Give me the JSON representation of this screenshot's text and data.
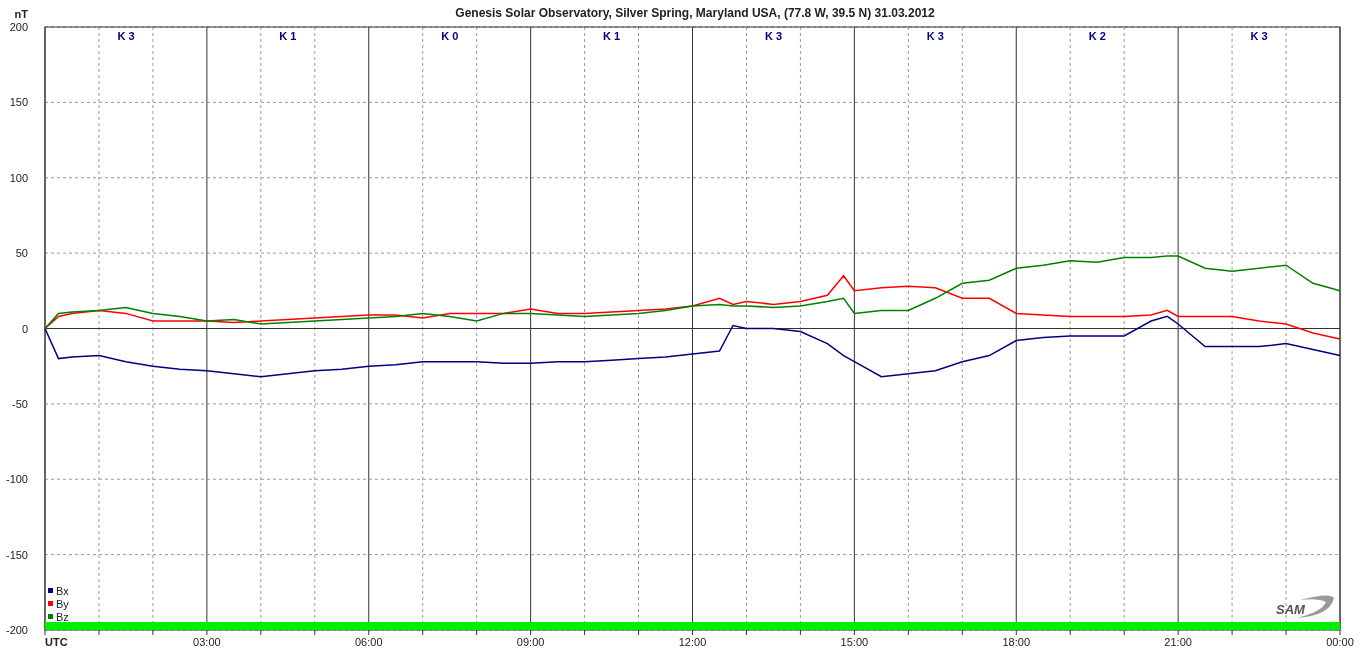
{
  "chart_data": {
    "type": "line",
    "title": "Genesis Solar Observatory, Silver Spring, Maryland USA, (77.8 W, 39.5 N)  31.03.2012",
    "ylabel": "nT",
    "xlim": [
      0,
      24
    ],
    "ylim": [
      -200,
      200
    ],
    "grid": true,
    "legend": true,
    "yticks": [
      -200,
      -150,
      -100,
      -50,
      0,
      50,
      100,
      150,
      200
    ],
    "xticks": [
      {
        "value": 0,
        "label": "UTC"
      },
      {
        "value": 3,
        "label": "03:00"
      },
      {
        "value": 6,
        "label": "06:00"
      },
      {
        "value": 9,
        "label": "09:00"
      },
      {
        "value": 12,
        "label": "12:00"
      },
      {
        "value": 15,
        "label": "15:00"
      },
      {
        "value": 18,
        "label": "18:00"
      },
      {
        "value": 21,
        "label": "21:00"
      },
      {
        "value": 24,
        "label": "00:00"
      }
    ],
    "x": [
      0,
      0.25,
      0.5,
      1,
      1.5,
      2,
      2.5,
      3,
      3.5,
      4,
      4.5,
      5,
      5.5,
      6,
      6.5,
      7,
      7.5,
      8,
      8.5,
      9,
      9.5,
      10,
      10.5,
      11,
      11.5,
      12,
      12.5,
      12.75,
      13,
      13.5,
      14,
      14.5,
      14.8,
      15,
      15.5,
      16,
      16.5,
      17,
      17.5,
      18,
      18.5,
      19,
      19.5,
      20,
      20.5,
      20.8,
      21,
      21.5,
      22,
      22.5,
      23,
      23.5,
      24
    ],
    "series": [
      {
        "name": "Bx",
        "color": "#000080",
        "values": [
          0,
          -20,
          -19,
          -18,
          -22,
          -25,
          -27,
          -28,
          -30,
          -32,
          -30,
          -28,
          -27,
          -25,
          -24,
          -22,
          -22,
          -22,
          -23,
          -23,
          -22,
          -22,
          -21,
          -20,
          -19,
          -17,
          -15,
          2,
          0,
          0,
          -2,
          -10,
          -18,
          -22,
          -32,
          -30,
          -28,
          -22,
          -18,
          -8,
          -6,
          -5,
          -5,
          -5,
          5,
          8,
          3,
          -12,
          -12,
          -12,
          -10,
          -14,
          -18
        ]
      },
      {
        "name": "By",
        "color": "#ff0000",
        "values": [
          0,
          8,
          10,
          12,
          10,
          5,
          5,
          5,
          4,
          5,
          6,
          7,
          8,
          9,
          9,
          7,
          10,
          10,
          10,
          13,
          10,
          10,
          11,
          12,
          13,
          15,
          20,
          16,
          18,
          16,
          18,
          22,
          35,
          25,
          27,
          28,
          27,
          20,
          20,
          10,
          9,
          8,
          8,
          8,
          9,
          12,
          8,
          8,
          8,
          5,
          3,
          -3,
          -7
        ]
      },
      {
        "name": "Bz",
        "color": "#008000",
        "values": [
          0,
          10,
          11,
          12,
          14,
          10,
          8,
          5,
          6,
          3,
          4,
          5,
          6,
          7,
          8,
          10,
          8,
          5,
          10,
          10,
          9,
          8,
          9,
          10,
          12,
          15,
          16,
          15,
          15,
          14,
          15,
          18,
          20,
          10,
          12,
          12,
          20,
          30,
          32,
          40,
          42,
          45,
          44,
          47,
          47,
          48,
          48,
          40,
          38,
          40,
          42,
          30,
          25
        ]
      }
    ]
  },
  "k_indices": [
    "K 3",
    "K 1",
    "K 0",
    "K 1",
    "K 3",
    "K 3",
    "K 2",
    "K 3"
  ],
  "logo": "SAM"
}
